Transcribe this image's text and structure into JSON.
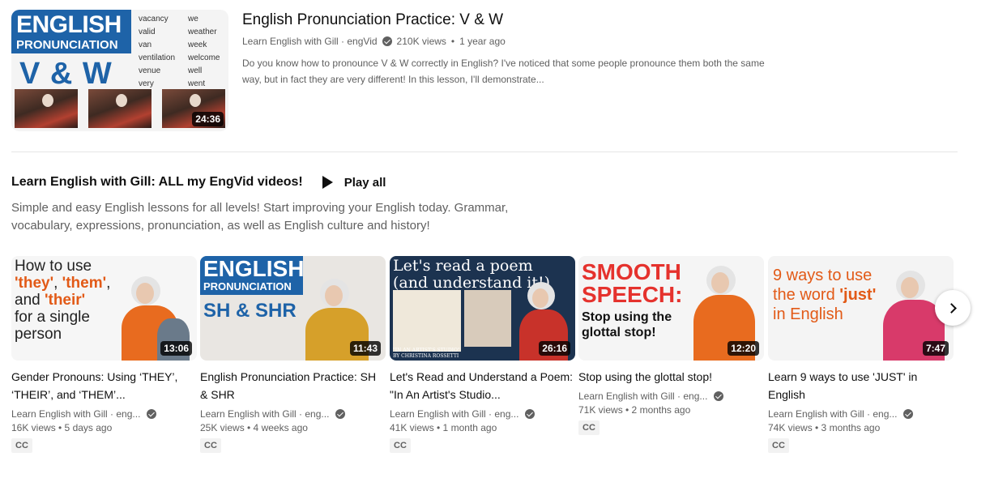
{
  "top_video": {
    "thumb": {
      "title_big": "ENGLISH",
      "title_small": "PRONUNCIATION",
      "letters": "V & W",
      "words_v": [
        "vacancy",
        "valid",
        "van",
        "ventilation",
        "venue",
        "very"
      ],
      "words_w": [
        "we",
        "weather",
        "week",
        "welcome",
        "well",
        "went"
      ],
      "duration": "24:36"
    },
    "title": "English Pronunciation Practice: V & W",
    "channel": "Learn English with Gill · engVid",
    "views": "210K views",
    "age": "1 year ago",
    "description": "Do you know how to pronounce V & W correctly in English? I've noticed that some people pronounce them both the same way, but in fact they are very different! In this lesson, I'll demonstrate..."
  },
  "shelf": {
    "title": "Learn English with Gill: ALL my EngVid videos!",
    "play_all": "Play all",
    "description": "Simple and easy English lessons for all levels! Start improving your English today. Grammar, vocabulary, expressions, pronunciation, as well as English culture and history!",
    "videos": [
      {
        "title": "Gender Pronouns: Using ‘THEY’, ‘THEIR’, and ‘THEM’...",
        "channel": "Learn English with Gill · eng...",
        "views": "16K views • 5 days ago",
        "badge": "CC",
        "duration": "13:06",
        "thumb_text": {
          "l1": "How to use",
          "they": "'they'",
          "them": "'them'",
          "and": "and",
          "their": "'their'",
          "l4": "for a single",
          "l5": "person"
        }
      },
      {
        "title": "English Pronunciation Practice: SH & SHR",
        "channel": "Learn English with Gill · eng...",
        "views": "25K views • 4 weeks ago",
        "badge": "CC",
        "duration": "11:43",
        "thumb_text": {
          "big": "ENGLISH",
          "small": "PRONUNCIATION",
          "sub": "SH & SHR"
        }
      },
      {
        "title": "Let's Read and Understand a Poem: \"In An Artist's Studio...",
        "channel": "Learn English with Gill · eng...",
        "views": "41K views • 1 month ago",
        "badge": "CC",
        "duration": "26:16",
        "thumb_text": {
          "l1": "Let's read a poem",
          "l2": "(and understand it!)",
          "caption1": "\"IN AN ARTIST'S STUDIO\"",
          "caption2": "BY CHRISTINA ROSSETTI"
        }
      },
      {
        "title": "Stop using the glottal stop!",
        "channel": "Learn English with Gill · eng...",
        "views": "71K views • 2 months ago",
        "badge": "CC",
        "duration": "12:20",
        "thumb_text": {
          "l1": "SMOOTH",
          "l2": "SPEECH:",
          "l3": "Stop using the",
          "l4": "glottal stop!"
        }
      },
      {
        "title": "Learn 9 ways to use 'JUST' in English",
        "channel": "Learn English with Gill · eng...",
        "views": "74K views • 3 months ago",
        "badge": "CC",
        "duration": "7:47",
        "thumb_text": {
          "l1": "9 ways to use",
          "l2a": "the word",
          "l2b": "'just'",
          "l3": "in English"
        }
      }
    ]
  }
}
